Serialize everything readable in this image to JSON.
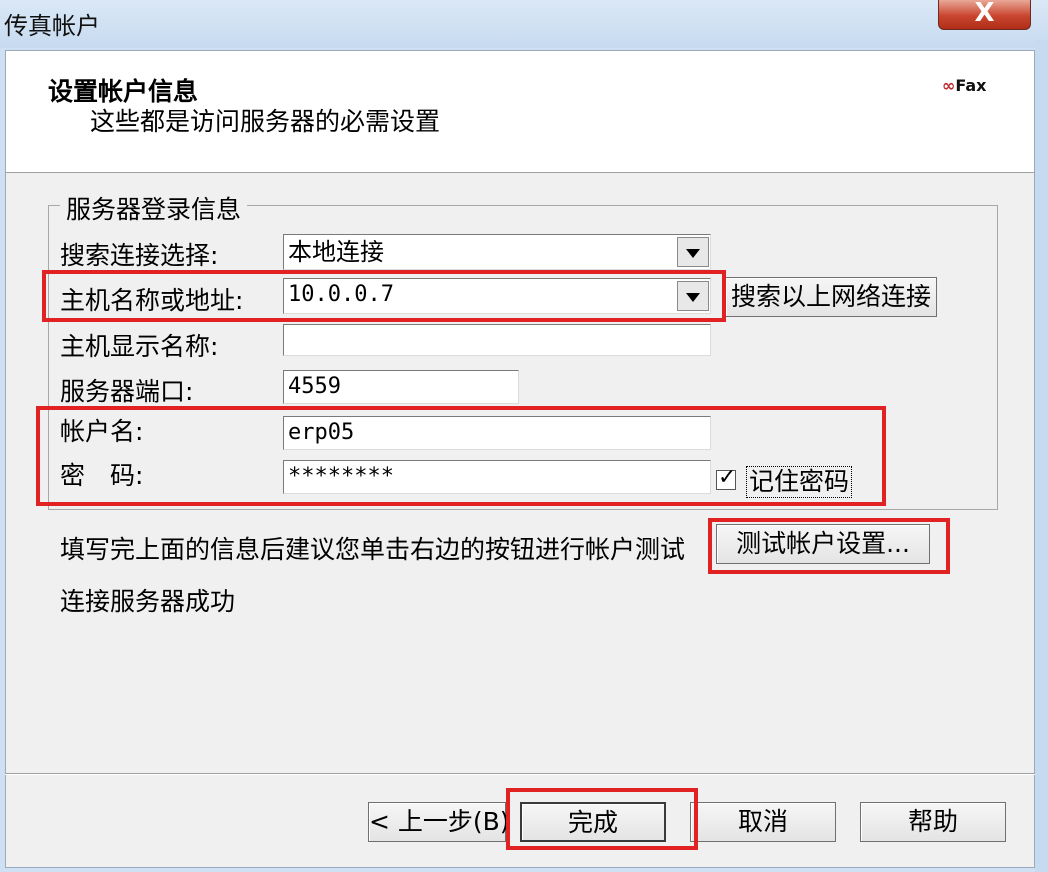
{
  "window": {
    "title": "传真帐户",
    "close_symbol": "X"
  },
  "header": {
    "title": "设置帐户信息",
    "subtitle": "这些都是访问服务器的必需设置",
    "logo_prefix": "∞",
    "logo_text": "Fax"
  },
  "group": {
    "legend": "服务器登录信息"
  },
  "fields": {
    "connection_type": {
      "label": "搜索连接选择:",
      "value": "本地连接"
    },
    "host": {
      "label": "主机名称或地址:",
      "value": "10.0.0.7"
    },
    "display_name": {
      "label": "主机显示名称:",
      "value": ""
    },
    "port": {
      "label": "服务器端口:",
      "value": "4559"
    },
    "account": {
      "label": "帐户名:",
      "value": "erp05"
    },
    "password": {
      "label": "密　码:",
      "value": "********"
    }
  },
  "remember_password": {
    "checked": true,
    "check_symbol": "✓",
    "label": "记住密码"
  },
  "search_network_button": "搜索以上网络连接",
  "hint_text": "填写完上面的信息后建议您单击右边的按钮进行帐户测试",
  "test_button": "测试帐户设置...",
  "status_text": "连接服务器成功",
  "footer": {
    "back": "< 上一步(B)",
    "finish": "完成",
    "cancel": "取消",
    "help": "帮助"
  },
  "colors": {
    "highlight": "#e02222",
    "dialog_bg": "#f0f0f0",
    "title_bg": "#c6daf0"
  }
}
